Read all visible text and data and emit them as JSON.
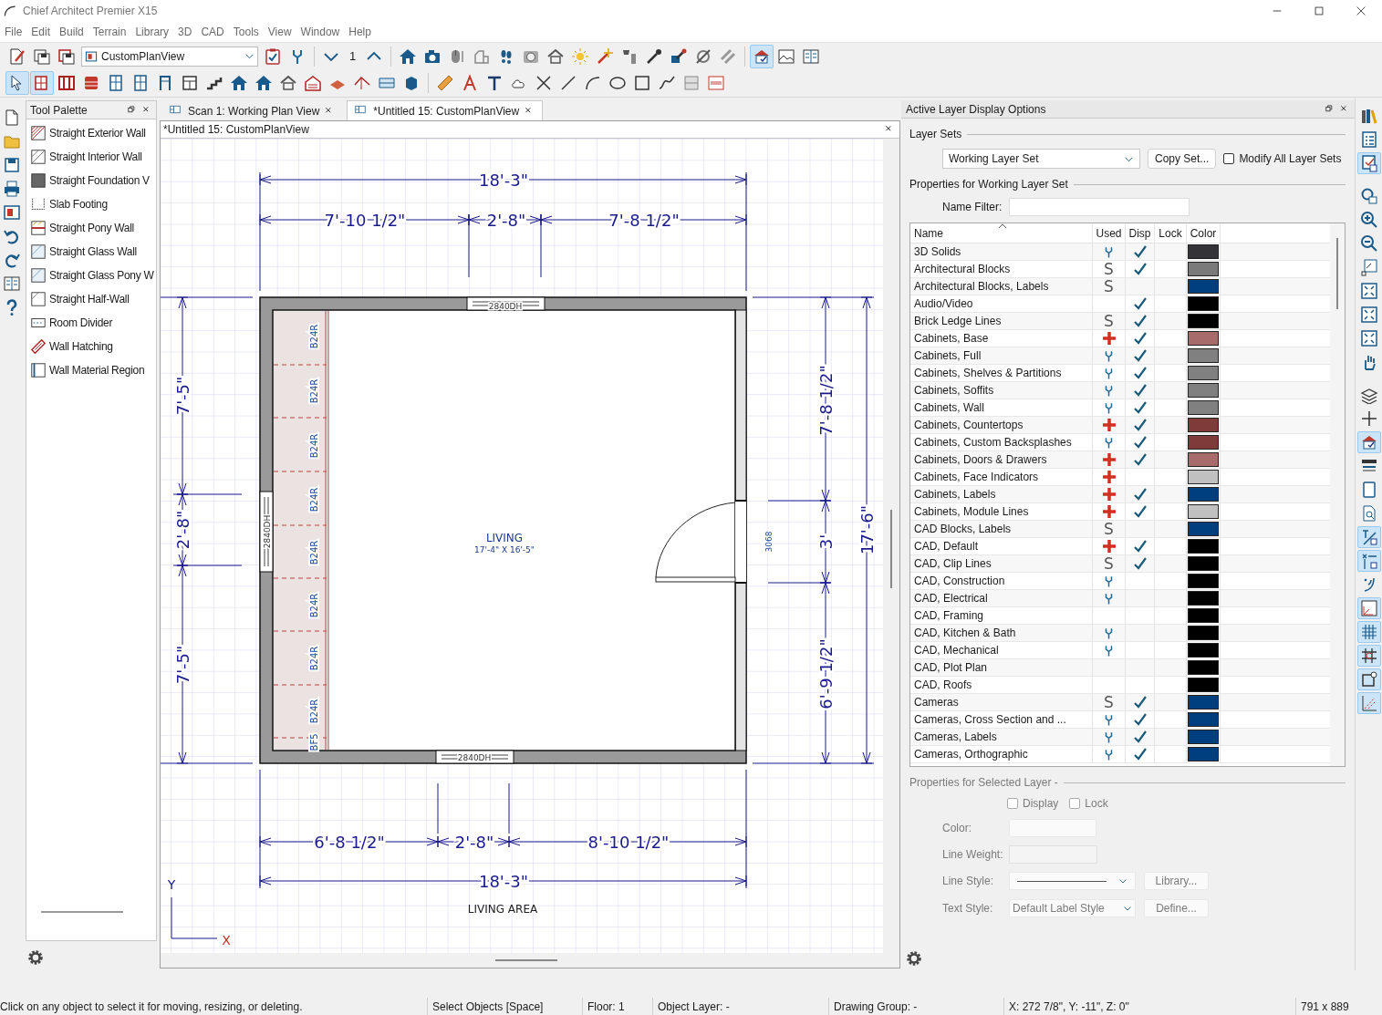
{
  "window": {
    "title": "Chief Architect Premier X15"
  },
  "menu": [
    "File",
    "Edit",
    "Build",
    "Terrain",
    "Library",
    "3D",
    "CAD",
    "Tools",
    "View",
    "Window",
    "Help"
  ],
  "toolbar_top": {
    "view_dropdown": "CustomPlanView",
    "floor": "1",
    "buttons": [
      {
        "selected": false
      },
      {
        "selected": false
      },
      {
        "selected": false
      },
      {
        "selected": false
      },
      {
        "selected": false
      },
      {
        "selected": false
      },
      {
        "selected": false
      },
      {
        "selected": false
      },
      {
        "selected": false
      },
      {
        "selected": false
      },
      {
        "selected": false
      },
      {
        "selected": false
      },
      {
        "selected": false
      },
      {
        "selected": false
      },
      {
        "selected": false
      },
      {
        "selected": false
      },
      {
        "selected": false
      },
      {
        "selected": false
      },
      {
        "selected": false
      },
      {
        "selected": false
      },
      {
        "selected": false
      },
      {
        "selected": true
      },
      {
        "selected": false
      },
      {
        "selected": false
      }
    ]
  },
  "toolbar_second": {
    "buttons": [
      {
        "selected": true
      },
      {
        "selected": true
      },
      {
        "selected": false
      },
      {
        "selected": false
      },
      {
        "selected": false
      },
      {
        "selected": false
      },
      {
        "selected": false
      },
      {
        "selected": false
      },
      {
        "selected": false
      },
      {
        "selected": false
      },
      {
        "selected": false
      },
      {
        "selected": false
      },
      {
        "selected": false
      },
      {
        "selected": false
      },
      {
        "selected": false
      },
      {
        "selected": false
      },
      {
        "selected": false
      },
      {
        "selected": false
      },
      {
        "selected": false
      },
      {
        "selected": false
      },
      {
        "selected": false
      },
      {
        "selected": false
      },
      {
        "selected": false
      },
      {
        "selected": false
      },
      {
        "selected": false
      },
      {
        "selected": false
      },
      {
        "selected": false
      },
      {
        "selected": false
      },
      {
        "selected": false
      }
    ]
  },
  "toolbar_right": {
    "buttons": [
      {
        "selected": false
      },
      {
        "selected": false
      },
      {
        "selected": true
      },
      {
        "selected": false
      },
      {
        "selected": false
      },
      {
        "selected": false
      },
      {
        "selected": false
      },
      {
        "selected": false
      },
      {
        "selected": false
      },
      {
        "selected": false
      },
      {
        "selected": false
      },
      {
        "selected": false
      },
      {
        "selected": false
      },
      {
        "selected": true
      },
      {
        "selected": false
      },
      {
        "selected": false
      },
      {
        "selected": false
      },
      {
        "selected": true
      },
      {
        "selected": true
      },
      {
        "selected": false
      },
      {
        "selected": true
      },
      {
        "selected": true
      },
      {
        "selected": true
      },
      {
        "selected": true
      },
      {
        "selected": true
      }
    ]
  },
  "tool_palette": {
    "title": "Tool Palette",
    "items": [
      "Straight Exterior Wall",
      "Straight Interior Wall",
      "Straight Foundation V",
      "Slab Footing",
      "Straight Pony Wall",
      "Straight Glass Wall",
      "Straight Glass Pony W",
      "Straight Half-Wall",
      "Room Divider",
      "Wall Hatching",
      "Wall Material Region"
    ]
  },
  "tabs": [
    {
      "label": "Scan 1:  Working Plan View",
      "selected": false
    },
    {
      "label": "*Untitled 15: CustomPlanView",
      "selected": true
    }
  ],
  "document": {
    "title": "*Untitled 15: CustomPlanView",
    "plan": {
      "room_name": "LIVING",
      "room_size": "17'-4\" X 16'-5\"",
      "area_label": "LIVING AREA",
      "windows": [
        "2840DH",
        "2840DH",
        "2840DH"
      ],
      "door": "3068",
      "cabinets": [
        "B24R",
        "B24R",
        "B24R",
        "B24R",
        "B24R",
        "B24R",
        "B24R",
        "B24R",
        "BF5"
      ],
      "dimensions": {
        "top_overall": "18'-3\"",
        "top": [
          "7'-10 1/2\"",
          "2'-8\"",
          "7'-8 1/2\""
        ],
        "bottom": [
          "6'-8 1/2\"",
          "2'-8\"",
          "8'-10 1/2\""
        ],
        "bottom_overall": "18'-3\"",
        "left": [
          "7'-5\"",
          "2'-8\"",
          "7'-5\""
        ],
        "right": [
          "7'-8 1/2\"",
          "3'",
          "6'-9 1/2\""
        ],
        "right_overall": "17'-6\""
      },
      "axis_y": "Y",
      "axis_x": "X"
    }
  },
  "layer_panel": {
    "title": "Active Layer Display Options",
    "layer_sets_label": "Layer Sets",
    "layer_set": "Working Layer Set",
    "copy_button": "Copy Set...",
    "modify_all": {
      "label": "Modify All Layer Sets",
      "checked": false
    },
    "properties_label": "Properties for  Working Layer Set",
    "name_filter_label": "Name Filter:",
    "columns": [
      "Name",
      "Used",
      "Disp",
      "Lock",
      "Color"
    ],
    "rows": [
      {
        "name": "3D Solids",
        "used": {
          "kind": "wrench"
        },
        "disp": true,
        "color": "#343438"
      },
      {
        "name": "Architectural Blocks",
        "used": {
          "kind": "shared",
          "text": "S"
        },
        "disp": true,
        "color": "#7a7a7a"
      },
      {
        "name": "Architectural Blocks, Labels",
        "used": {
          "kind": "shared",
          "text": "S"
        },
        "disp": false,
        "color": "#003f7f"
      },
      {
        "name": "Audio/Video",
        "disp": true,
        "color": "#000000"
      },
      {
        "name": "Brick Ledge Lines",
        "used": {
          "kind": "shared",
          "text": "S"
        },
        "disp": true,
        "color": "#000000"
      },
      {
        "name": "Cabinets,  Base",
        "used": {
          "kind": "plus"
        },
        "disp": true,
        "color": "#a86b6b"
      },
      {
        "name": "Cabinets,  Full",
        "used": {
          "kind": "wrench"
        },
        "disp": true,
        "color": "#808080"
      },
      {
        "name": "Cabinets,  Shelves & Partitions",
        "used": {
          "kind": "wrench"
        },
        "disp": true,
        "color": "#808080"
      },
      {
        "name": "Cabinets,  Soffits",
        "used": {
          "kind": "wrench"
        },
        "disp": true,
        "color": "#808080"
      },
      {
        "name": "Cabinets,  Wall",
        "used": {
          "kind": "wrench"
        },
        "disp": true,
        "color": "#808080"
      },
      {
        "name": "Cabinets, Countertops",
        "used": {
          "kind": "plus"
        },
        "disp": true,
        "color": "#7f3a3a"
      },
      {
        "name": "Cabinets, Custom Backsplashes",
        "used": {
          "kind": "wrench"
        },
        "disp": true,
        "color": "#7f3a3a"
      },
      {
        "name": "Cabinets, Doors & Drawers",
        "used": {
          "kind": "plus"
        },
        "disp": true,
        "color": "#a86b6b"
      },
      {
        "name": "Cabinets, Face Indicators",
        "used": {
          "kind": "plus"
        },
        "disp": false,
        "color": "#c0c0c0"
      },
      {
        "name": "Cabinets, Labels",
        "used": {
          "kind": "plus"
        },
        "disp": true,
        "color": "#003f7f"
      },
      {
        "name": "Cabinets, Module Lines",
        "used": {
          "kind": "plus"
        },
        "disp": true,
        "color": "#c0c0c0"
      },
      {
        "name": "CAD Blocks, Labels",
        "used": {
          "kind": "shared",
          "text": "S"
        },
        "disp": false,
        "color": "#003f7f"
      },
      {
        "name": "CAD,  Default",
        "used": {
          "kind": "plus"
        },
        "disp": true,
        "color": "#000000"
      },
      {
        "name": "CAD, Clip Lines",
        "used": {
          "kind": "shared",
          "text": "S"
        },
        "disp": true,
        "color": "#000000"
      },
      {
        "name": "CAD, Construction",
        "used": {
          "kind": "wrench"
        },
        "disp": false,
        "color": "#000000"
      },
      {
        "name": "CAD, Electrical",
        "used": {
          "kind": "wrench"
        },
        "disp": false,
        "color": "#000000"
      },
      {
        "name": "CAD, Framing",
        "disp": false,
        "color": "#000000"
      },
      {
        "name": "CAD, Kitchen & Bath",
        "used": {
          "kind": "wrench"
        },
        "disp": false,
        "color": "#000000"
      },
      {
        "name": "CAD, Mechanical",
        "used": {
          "kind": "wrench"
        },
        "disp": false,
        "color": "#000000"
      },
      {
        "name": "CAD, Plot Plan",
        "disp": false,
        "color": "#000000"
      },
      {
        "name": "CAD, Roofs",
        "disp": false,
        "color": "#000000"
      },
      {
        "name": "Cameras",
        "used": {
          "kind": "shared",
          "text": "S"
        },
        "disp": true,
        "color": "#003f7f"
      },
      {
        "name": "Cameras, Cross Section and ...",
        "used": {
          "kind": "wrench"
        },
        "disp": true,
        "color": "#003f7f"
      },
      {
        "name": "Cameras, Labels",
        "used": {
          "kind": "wrench"
        },
        "disp": true,
        "color": "#003f7f"
      },
      {
        "name": "Cameras, Orthographic",
        "used": {
          "kind": "wrench"
        },
        "disp": true,
        "color": "#003f7f"
      }
    ],
    "selected_layer": {
      "title": "Properties for Selected Layer -",
      "display": {
        "label": "Display",
        "checked": false
      },
      "lock": {
        "label": "Lock",
        "checked": false
      },
      "color_label": "Color:",
      "line_weight_label": "Line Weight:",
      "line_style_label": "Line Style:",
      "library_button": "Library...",
      "text_style_label": "Text Style:",
      "text_style": "Default Label Style",
      "define_button": "Define..."
    }
  },
  "status_bar": [
    "Click on any object to select it for moving, resizing, or deleting.",
    "Select Objects [Space]",
    "Floor: 1",
    "Object Layer: -",
    "Drawing Group: -",
    "X: 272 7/8\", Y: -11\", Z: 0\"",
    "791 x 889"
  ]
}
